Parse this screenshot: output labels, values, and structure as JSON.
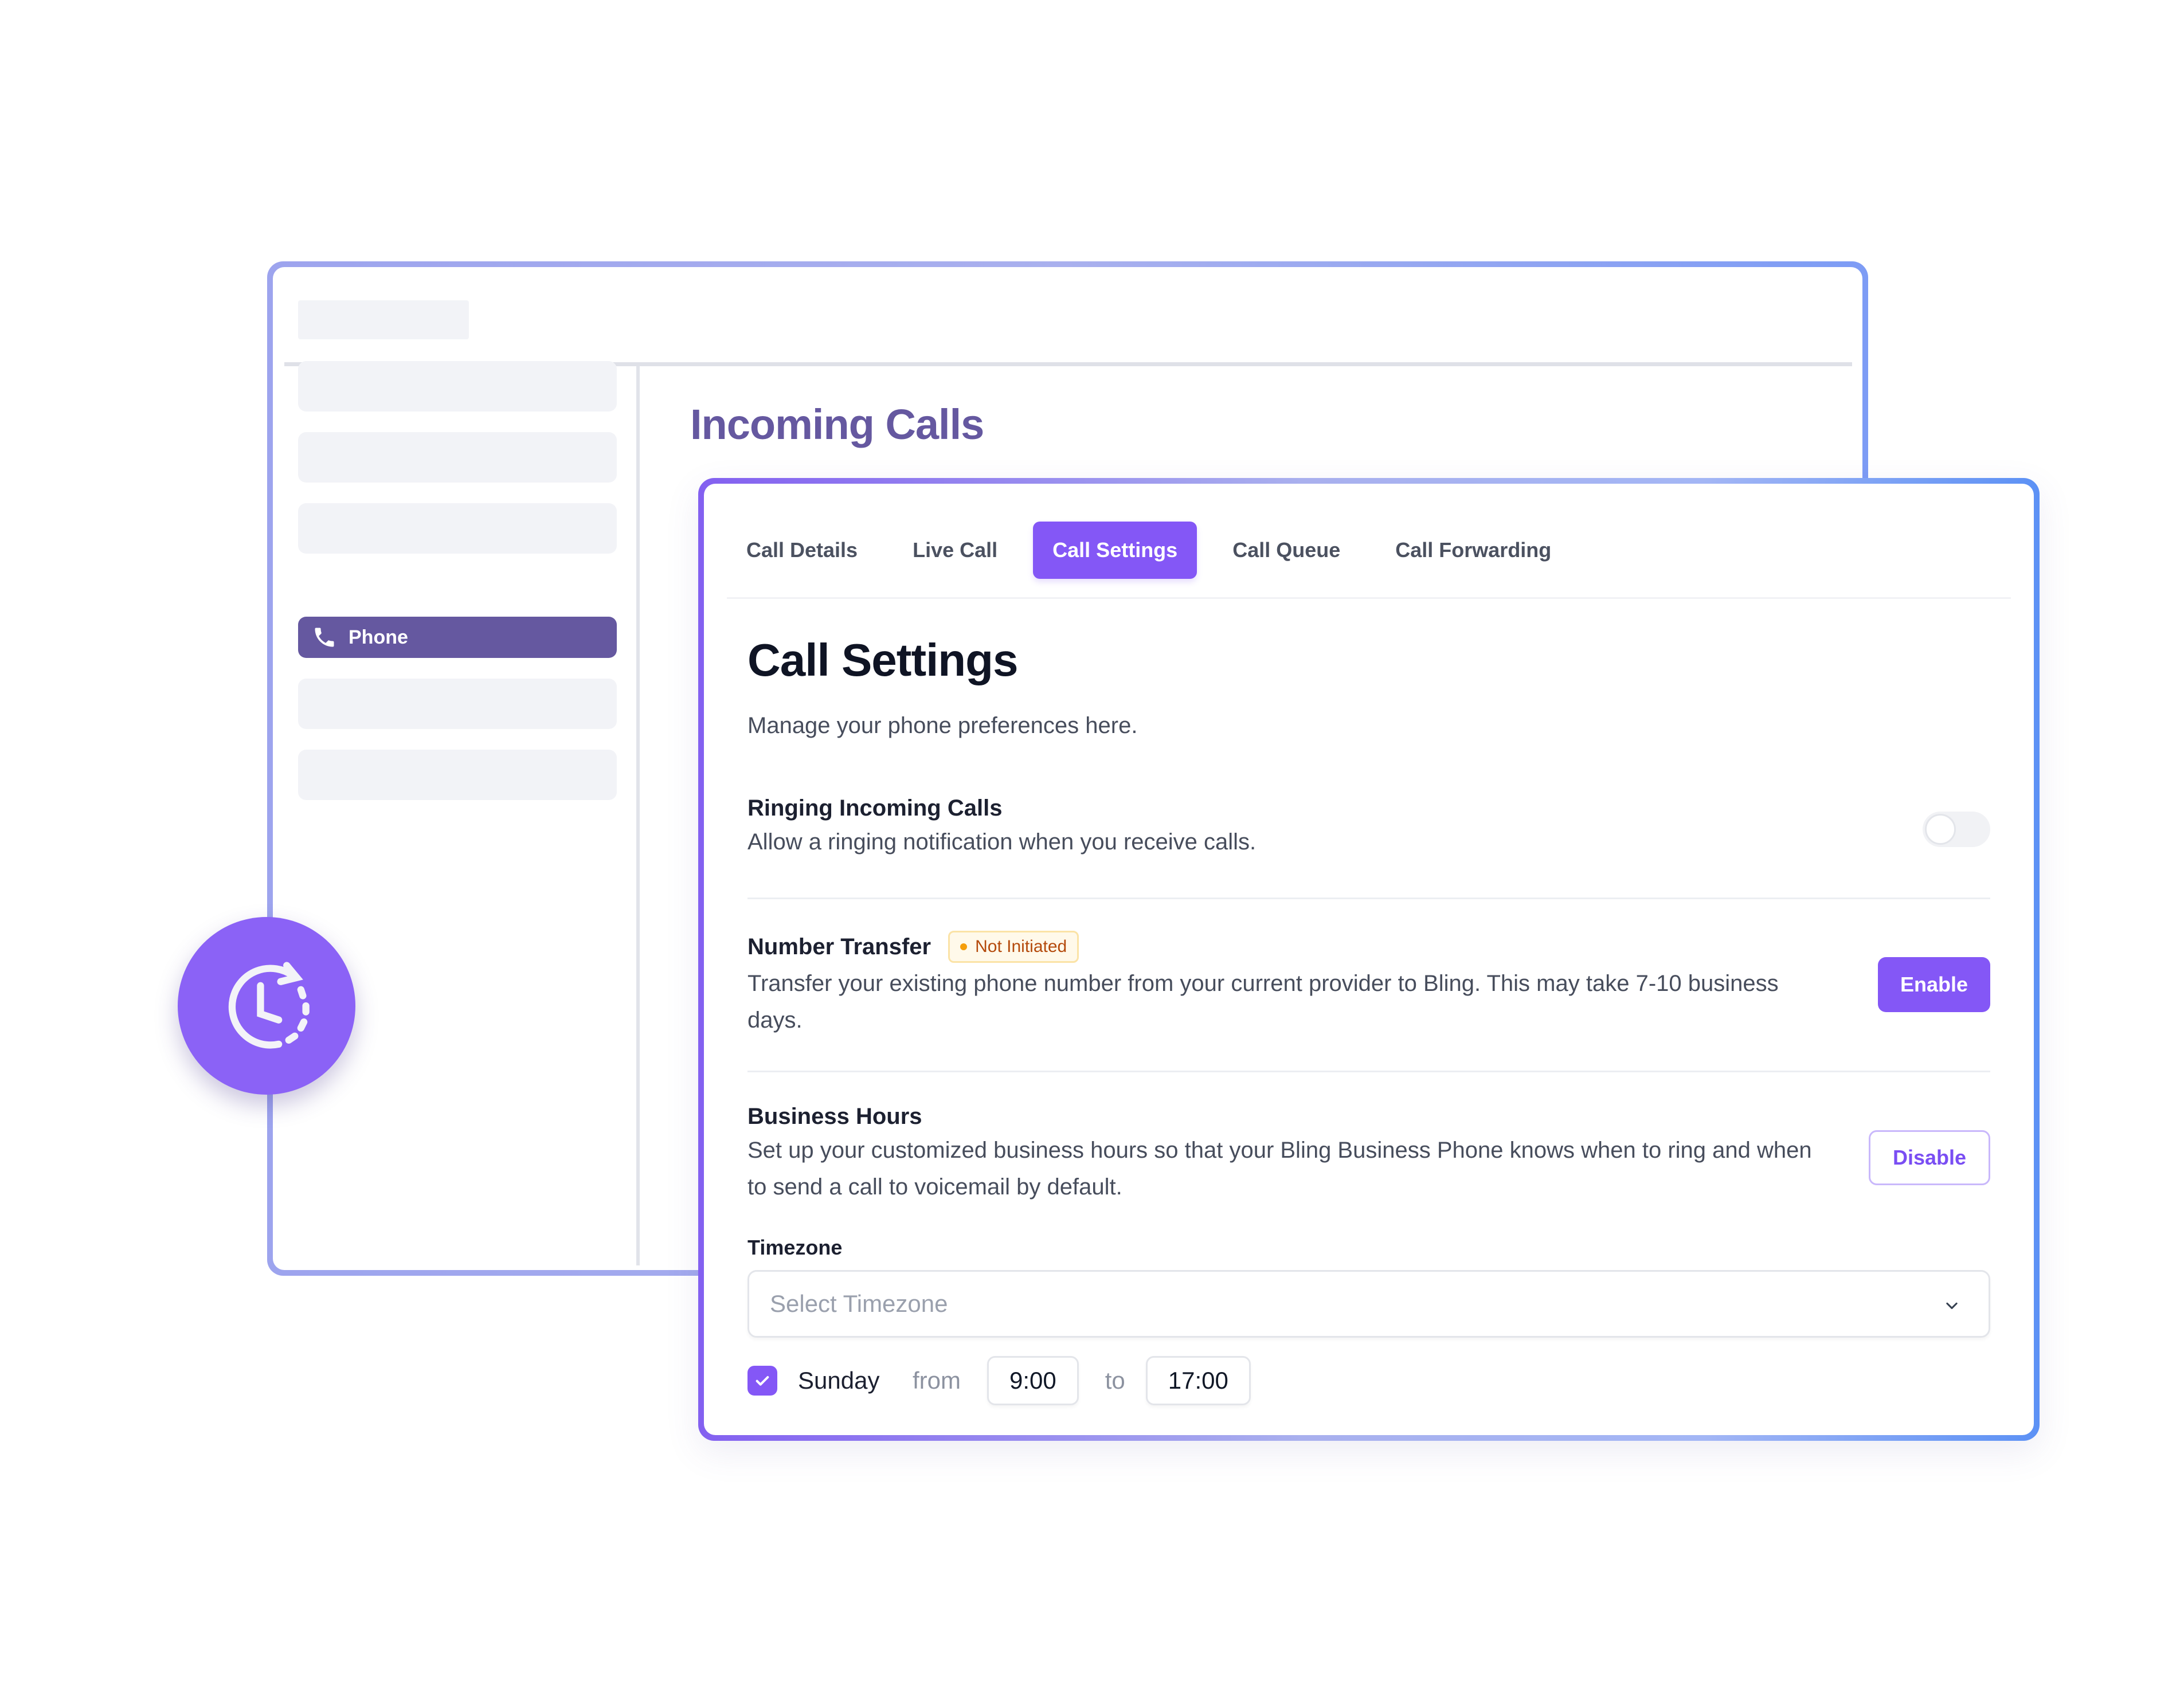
{
  "back_window": {
    "page_title": "Incoming Calls",
    "sidebar": {
      "active_item": {
        "label": "Phone",
        "icon": "phone-icon"
      },
      "placeholder_items_count": 5
    }
  },
  "badge": {
    "icon": "clock-rotate-icon"
  },
  "card": {
    "tabs": [
      {
        "label": "Call Details",
        "active": false
      },
      {
        "label": "Live Call",
        "active": false
      },
      {
        "label": "Call Settings",
        "active": true
      },
      {
        "label": "Call Queue",
        "active": false
      },
      {
        "label": "Call Forwarding",
        "active": false
      }
    ],
    "title": "Call Settings",
    "subtitle": "Manage your phone preferences here.",
    "settings": {
      "ringing": {
        "title": "Ringing Incoming Calls",
        "description": "Allow a ringing notification when you receive calls.",
        "toggle_on": false
      },
      "number_transfer": {
        "title": "Number Transfer",
        "status": "Not Initiated",
        "description": "Transfer your existing phone number from your current provider to Bling. This may take 7-10 business days.",
        "button_label": "Enable"
      },
      "business_hours": {
        "title": "Business Hours",
        "description": "Set up your customized business hours so that your Bling Business Phone knows when to ring and when to send a call to voicemail by default.",
        "button_label": "Disable",
        "timezone_label": "Timezone",
        "timezone_placeholder": "Select Timezone",
        "schedule": [
          {
            "day": "Sunday",
            "checked": true,
            "from_label": "from",
            "from": "9:00",
            "to_label": "to",
            "to": "17:00"
          }
        ]
      }
    }
  },
  "colors": {
    "accent": "#8457f6",
    "sidebar_active": "#6558a0",
    "status_text": "#b44a0c",
    "status_dot": "#f59e0b"
  }
}
